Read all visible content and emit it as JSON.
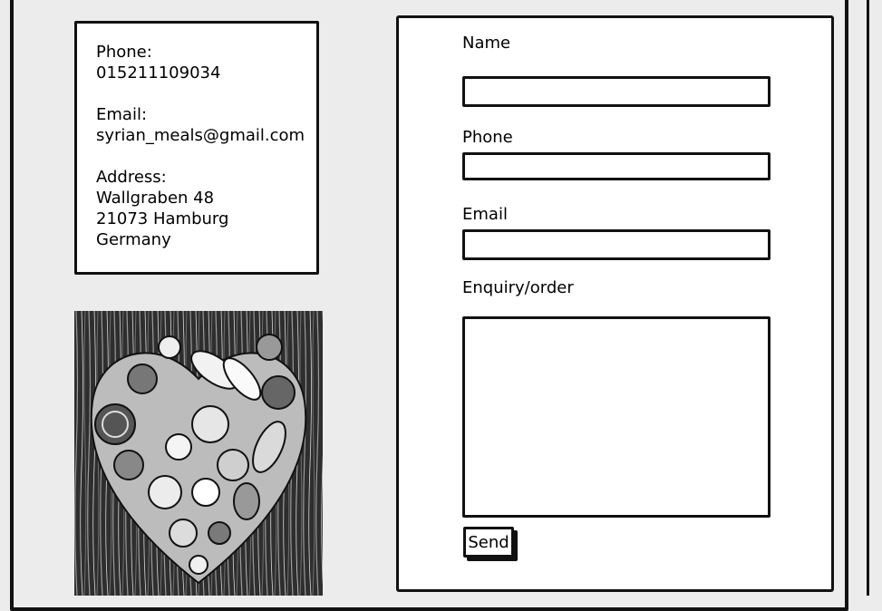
{
  "contact": {
    "phone_label": "Phone:",
    "phone_value": "015211109034",
    "email_label": "Email:",
    "email_value": "syrian_meals@gmail.com",
    "address_label": "Address:",
    "address_lines": [
      "Wallgraben 48",
      "21073 Hamburg",
      "Germany"
    ]
  },
  "image": {
    "icon": "vegetable-heart-photo"
  },
  "form": {
    "name_label": "Name",
    "name_value": "",
    "phone_label": "Phone",
    "phone_value": "",
    "email_label": "Email",
    "email_value": "",
    "enquiry_label": "Enquiry/order",
    "enquiry_value": "",
    "send_label": "Send"
  }
}
